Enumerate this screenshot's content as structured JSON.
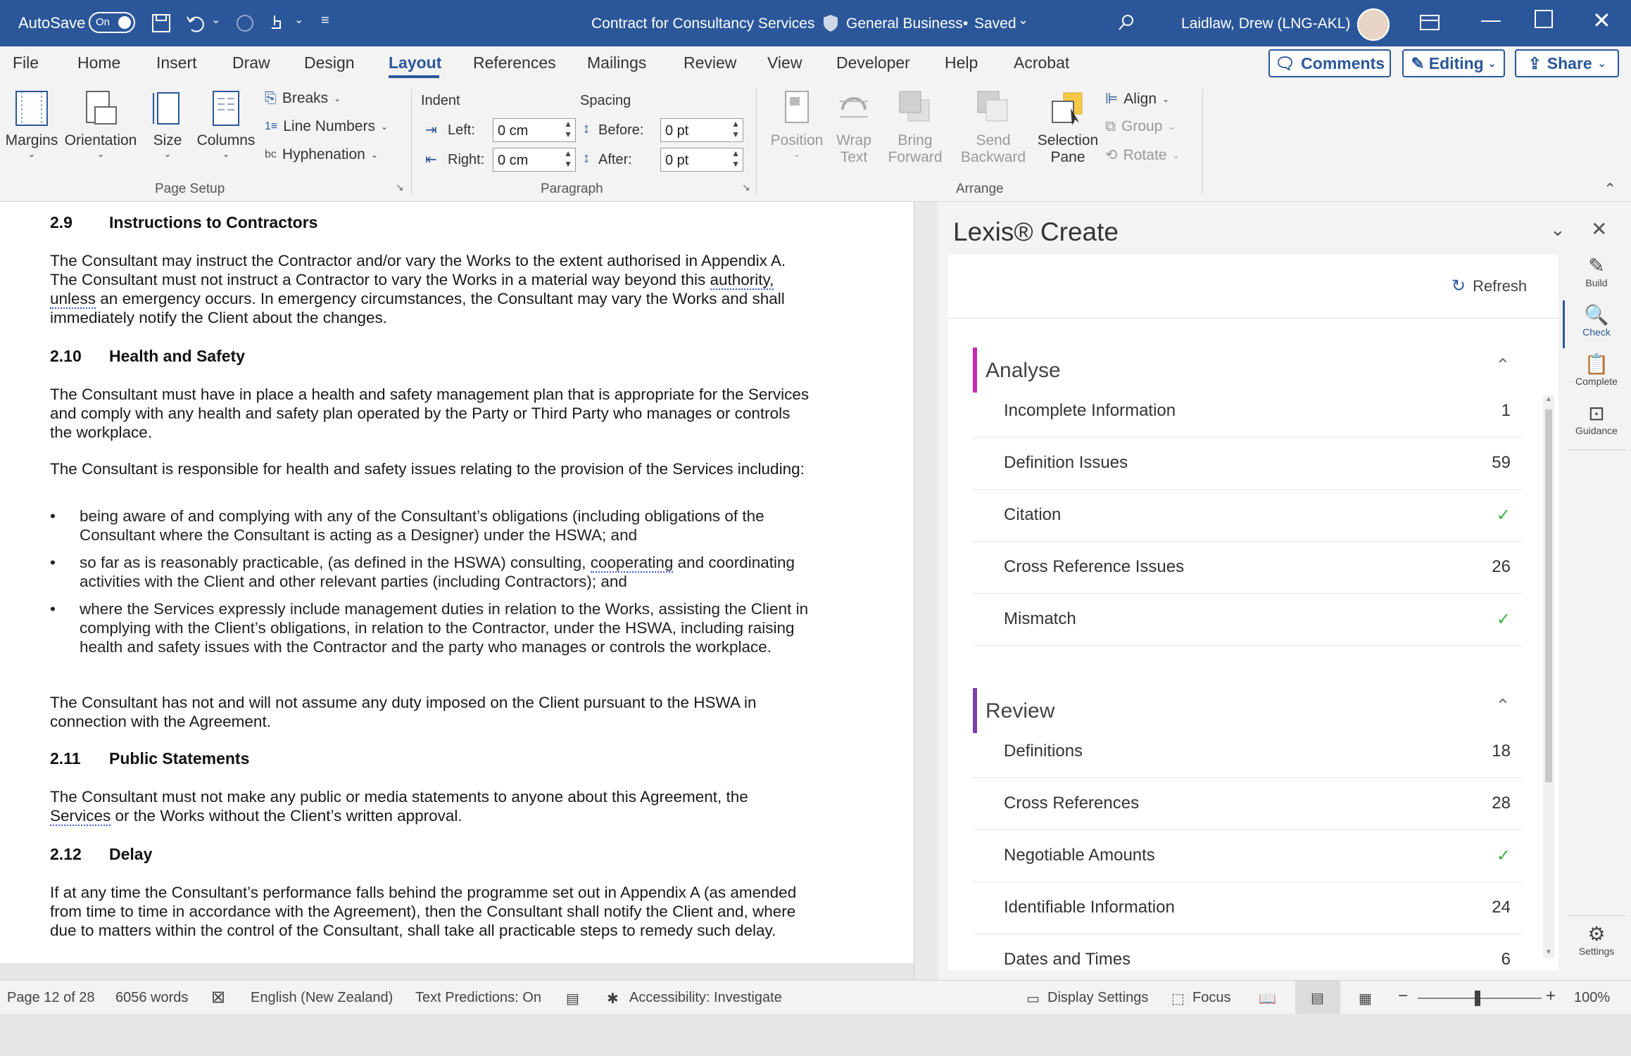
{
  "titlebar": {
    "autosave_label": "AutoSave",
    "autosave_state": "On",
    "doc_title": "Contract for Consultancy Services",
    "sensitivity": "General Business",
    "save_state": "Saved",
    "user_name": "Laidlaw, Drew (LNG-AKL)"
  },
  "menu": {
    "items": [
      "File",
      "Home",
      "Insert",
      "Draw",
      "Design",
      "Layout",
      "References",
      "Mailings",
      "Review",
      "View",
      "Developer",
      "Help",
      "Acrobat"
    ],
    "active": "Layout",
    "comments_label": "Comments",
    "editing_label": "Editing",
    "share_label": "Share"
  },
  "ribbon": {
    "page_setup": {
      "margins": "Margins",
      "orientation": "Orientation",
      "size": "Size",
      "columns": "Columns",
      "breaks": "Breaks",
      "line_numbers": "Line Numbers",
      "hyphenation": "Hyphenation",
      "group_label": "Page Setup"
    },
    "paragraph": {
      "indent_label": "Indent",
      "spacing_label": "Spacing",
      "left_label": "Left:",
      "right_label": "Right:",
      "before_label": "Before:",
      "after_label": "After:",
      "left_value": "0 cm",
      "right_value": "0 cm",
      "before_value": "0 pt",
      "after_value": "0 pt",
      "group_label": "Paragraph"
    },
    "arrange": {
      "position": "Position",
      "wrap_1": "Wrap",
      "wrap_2": "Text",
      "bring_1": "Bring",
      "bring_2": "Forward",
      "send_1": "Send",
      "send_2": "Backward",
      "sel_1": "Selection",
      "sel_2": "Pane",
      "align": "Align",
      "group": "Group",
      "rotate": "Rotate",
      "group_label": "Arrange"
    }
  },
  "document": {
    "h29": {
      "num": "2.9",
      "title": "Instructions to Contractors"
    },
    "p29_a": "The Consultant may instruct the Contractor and/or vary the Works to the extent authorised in Appendix A.  The Consultant must not instruct a Contractor to vary the Works in a material way beyond this ",
    "p29_u": "authority, unless",
    "p29_b": " an emergency occurs.  In emergency circumstances, the Consultant may vary the Works and shall immediately notify the Client about the changes.",
    "h210": {
      "num": "2.10",
      "title": "Health and Safety"
    },
    "p210_1": "The Consultant must have in place a health and safety management plan that is appropriate for the Services and comply with any health and safety plan operated by the Party or Third Party who manages or controls the workplace.",
    "p210_2": "The Consultant is responsible for health and safety issues relating to the provision of the Services including:",
    "bullet1": "being aware of and complying with any of the Consultant’s obligations (including obligations of the Consultant where the Consultant is acting as a Designer) under the HSWA; and",
    "bullet2_a": "so far as is reasonably practicable, (as defined in the HSWA) consulting, ",
    "bullet2_u": "cooperating",
    "bullet2_b": " and coordinating activities with the Client and other relevant parties (including Contractors); and",
    "bullet3": "where the Services expressly include management duties in relation to the Works, assisting the Client in complying with the Client’s obligations, in relation to the Contractor, under the HSWA, including raising health and safety issues with the Contractor and the party who manages or controls the workplace.",
    "p210_3": "The Consultant has not and will not assume any duty imposed on the Client pursuant to the HSWA in connection with the Agreement.",
    "h211": {
      "num": "2.11",
      "title": "Public Statements"
    },
    "p211_a": "The Consultant must not make any public or media statements to anyone about this Agreement, the ",
    "p211_u": "Services",
    "p211_b": " or the Works without the Client’s written approval.",
    "h212": {
      "num": "2.12",
      "title": "Delay"
    },
    "p212": "If at any time the Consultant’s performance falls behind the programme set out in Appendix A (as amended from time to time in accordance with the Agreement), then the Consultant shall notify the Client and, where due to matters within the control of the Consultant, shall take all practicable steps to remedy such delay."
  },
  "lexis": {
    "title": "Lexis® Create",
    "refresh": "Refresh",
    "analyse": {
      "title": "Analyse",
      "color": "#c62bb4",
      "rows": [
        {
          "label": "Incomplete Information",
          "value": "1"
        },
        {
          "label": "Definition Issues",
          "value": "59"
        },
        {
          "label": "Citation",
          "value": "✓"
        },
        {
          "label": "Cross Reference Issues",
          "value": "26"
        },
        {
          "label": "Mismatch",
          "value": "✓"
        }
      ]
    },
    "review": {
      "title": "Review",
      "color": "#7b3fa8",
      "rows": [
        {
          "label": "Definitions",
          "value": "18"
        },
        {
          "label": "Cross References",
          "value": "28"
        },
        {
          "label": "Negotiable Amounts",
          "value": "✓"
        },
        {
          "label": "Identifiable Information",
          "value": "24"
        },
        {
          "label": "Dates and Times",
          "value": "6"
        }
      ]
    },
    "tools": [
      "Build",
      "Check",
      "Complete",
      "Guidance"
    ],
    "settings": "Settings"
  },
  "status": {
    "page": "Page 12 of 28",
    "words": "6056 words",
    "language": "English (New Zealand)",
    "predictions": "Text Predictions: On",
    "accessibility": "Accessibility: Investigate",
    "display_settings": "Display Settings",
    "focus": "Focus",
    "zoom": "100%"
  },
  "colors": {
    "titlebar": "#2b579a",
    "check": "#3fae49",
    "accent_blue": "#2b579a"
  }
}
